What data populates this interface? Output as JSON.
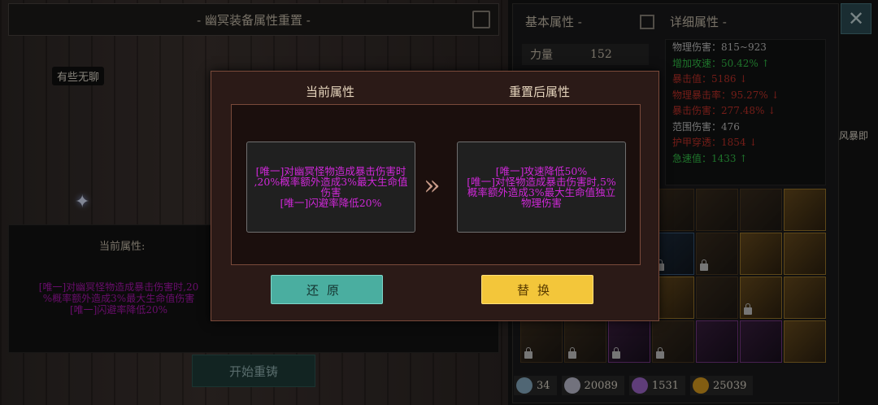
{
  "screen_title": "- 幽冥装备属性重置 -",
  "bored_tag": "有些无聊",
  "bg_panel": {
    "label": "当前属性:",
    "lines": [
      "[唯一]对幽冥怪物造成暴击伤害时,20",
      "%概率额外造成3%最大生命值伤害",
      "[唯一]闪避率降低20%"
    ],
    "start_button": "开始重铸"
  },
  "right_panel": {
    "basic_title": "基本属性 -",
    "detail_title": "详细属性 -",
    "strength_label": "力量",
    "strength_value": "152",
    "details": [
      {
        "text": "物理伤害：815~923",
        "color": "#c9c9c9"
      },
      {
        "text": "增加攻速：50.42% ↑",
        "color": "#35c64a"
      },
      {
        "text": "暴击值：5186 ↓",
        "color": "#c8332a"
      },
      {
        "text": "物理暴击率：95.27% ↓",
        "color": "#c8332a"
      },
      {
        "text": "暴击伤害：277.48% ↓",
        "color": "#c8332a"
      },
      {
        "text": "范围伤害：476",
        "color": "#c9c9c9"
      },
      {
        "text": "护甲穿透：1854 ↓",
        "color": "#c8332a"
      },
      {
        "text": "急速值：1433 ↑",
        "color": "#35c64a"
      }
    ],
    "side_text": "风暴即",
    "close_glyph": "✕"
  },
  "inventory": [
    {
      "tier": "default",
      "lock": false
    },
    {
      "tier": "default",
      "lock": false
    },
    {
      "tier": "default",
      "lock": false
    },
    {
      "tier": "default",
      "lock": false
    },
    {
      "tier": "default",
      "lock": false
    },
    {
      "tier": "default",
      "lock": false
    },
    {
      "tier": "gold",
      "lock": false
    },
    {
      "tier": "default",
      "lock": false
    },
    {
      "tier": "gold",
      "lock": false
    },
    {
      "tier": "purple",
      "lock": true
    },
    {
      "tier": "blue",
      "lock": true
    },
    {
      "tier": "default",
      "lock": true
    },
    {
      "tier": "gold",
      "lock": false
    },
    {
      "tier": "gold",
      "lock": false
    },
    {
      "tier": "default",
      "lock": false
    },
    {
      "tier": "gold",
      "lock": false
    },
    {
      "tier": "default",
      "lock": false
    },
    {
      "tier": "gold",
      "lock": false
    },
    {
      "tier": "default",
      "lock": false
    },
    {
      "tier": "gold",
      "lock": true
    },
    {
      "tier": "gold",
      "lock": false
    },
    {
      "tier": "default",
      "lock": true
    },
    {
      "tier": "default",
      "lock": true
    },
    {
      "tier": "purple",
      "lock": true
    },
    {
      "tier": "default",
      "lock": true
    },
    {
      "tier": "purple",
      "lock": false
    },
    {
      "tier": "purple",
      "lock": false
    },
    {
      "tier": "gold",
      "lock": false
    }
  ],
  "currency": [
    {
      "value": "34",
      "icon_color": "#8ab0c8",
      "icon": "gem-icon"
    },
    {
      "value": "20089",
      "icon_color": "#c5c5d8",
      "icon": "silver-coin-icon"
    },
    {
      "value": "1531",
      "icon_color": "#a46ad0",
      "icon": "purple-crystal-icon"
    },
    {
      "value": "25039",
      "icon_color": "#e0a020",
      "icon": "gold-coin-icon"
    }
  ],
  "modal": {
    "current_title": "当前属性",
    "reset_title": "重置后属性",
    "current_lines": [
      "[唯一]对幽冥怪物造成暴击伤害时",
      ",20%概率额外造成3%最大生命值",
      "伤害",
      "[唯一]闪避率降低20%"
    ],
    "reset_lines": [
      "[唯一]攻速降低50%",
      "[唯一]对怪物造成暴击伤害时,5%",
      "概率额外造成3%最大生命值独立",
      "物理伤害"
    ],
    "arrow_glyph": "»",
    "restore_label": "还原",
    "replace_label": "替换",
    "attr_text_color": "#cf28d8"
  }
}
